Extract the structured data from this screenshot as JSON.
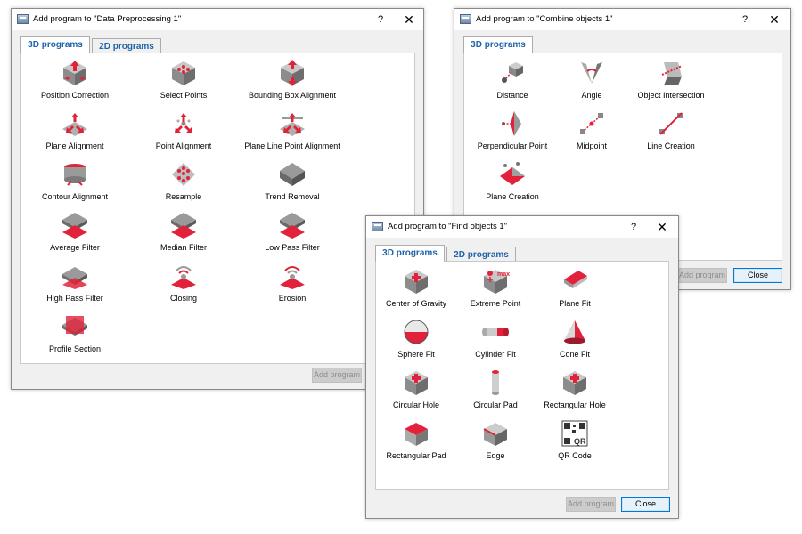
{
  "dialogs": {
    "dp": {
      "title": "Add program to \"Data Preprocessing 1\"",
      "help": "?",
      "close": "✕",
      "tabs": [
        "3D programs",
        "2D programs"
      ],
      "items": [
        {
          "label": "Position Correction",
          "icon": "position-correction-icon"
        },
        {
          "label": "Select Points",
          "icon": "select-points-icon"
        },
        {
          "label": "Bounding Box Alignment",
          "icon": "bounding-box-alignment-icon"
        },
        {
          "label": "Plane Alignment",
          "icon": "plane-alignment-icon"
        },
        {
          "label": "Point Alignment",
          "icon": "point-alignment-icon"
        },
        {
          "label": "Plane Line Point Alignment",
          "icon": "plane-line-point-alignment-icon"
        },
        {
          "label": "Contour Alignment",
          "icon": "contour-alignment-icon"
        },
        {
          "label": "Resample",
          "icon": "resample-icon"
        },
        {
          "label": "Trend Removal",
          "icon": "trend-removal-icon"
        },
        {
          "label": "Average Filter",
          "icon": "average-filter-icon"
        },
        {
          "label": "Median Filter",
          "icon": "median-filter-icon"
        },
        {
          "label": "Low Pass Filter",
          "icon": "low-pass-filter-icon"
        },
        {
          "label": "High Pass Filter",
          "icon": "high-pass-filter-icon"
        },
        {
          "label": "Closing",
          "icon": "closing-icon"
        },
        {
          "label": "Erosion",
          "icon": "erosion-icon"
        },
        {
          "label": "Profile Section",
          "icon": "profile-section-icon"
        }
      ],
      "add_button": "Add program"
    },
    "co": {
      "title": "Add program to \"Combine objects 1\"",
      "help": "?",
      "close": "✕",
      "tabs": [
        "3D programs"
      ],
      "items": [
        {
          "label": "Distance",
          "icon": "distance-icon"
        },
        {
          "label": "Angle",
          "icon": "angle-icon"
        },
        {
          "label": "Object Intersection",
          "icon": "object-intersection-icon"
        },
        {
          "label": "Perpendicular Point",
          "icon": "perpendicular-point-icon"
        },
        {
          "label": "Midpoint",
          "icon": "midpoint-icon"
        },
        {
          "label": "Line Creation",
          "icon": "line-creation-icon"
        },
        {
          "label": "Plane Creation",
          "icon": "plane-creation-icon"
        }
      ],
      "add_button": "Add program",
      "close_button": "Close"
    },
    "fo": {
      "title": "Add program to \"Find objects 1\"",
      "help": "?",
      "close": "✕",
      "tabs": [
        "3D programs",
        "2D programs"
      ],
      "items": [
        {
          "label": "Center of Gravity",
          "icon": "center-of-gravity-icon"
        },
        {
          "label": "Extreme Point",
          "icon": "extreme-point-icon",
          "icon_text": "max"
        },
        {
          "label": "Plane Fit",
          "icon": "plane-fit-icon"
        },
        {
          "label": "Sphere Fit",
          "icon": "sphere-fit-icon"
        },
        {
          "label": "Cylinder Fit",
          "icon": "cylinder-fit-icon"
        },
        {
          "label": "Cone Fit",
          "icon": "cone-fit-icon"
        },
        {
          "label": "Circular Hole",
          "icon": "circular-hole-icon"
        },
        {
          "label": "Circular Pad",
          "icon": "circular-pad-icon"
        },
        {
          "label": "Rectangular Hole",
          "icon": "rectangular-hole-icon"
        },
        {
          "label": "Rectangular Pad",
          "icon": "rectangular-pad-icon"
        },
        {
          "label": "Edge",
          "icon": "edge-icon"
        },
        {
          "label": "QR Code",
          "icon": "qr-code-icon",
          "icon_text": "QR"
        }
      ],
      "add_button": "Add program",
      "close_button": "Close"
    }
  },
  "colors": {
    "accent_red": "#e2223a",
    "tab_blue": "#1f63a8",
    "surface_gray": "#9a9a9a"
  }
}
